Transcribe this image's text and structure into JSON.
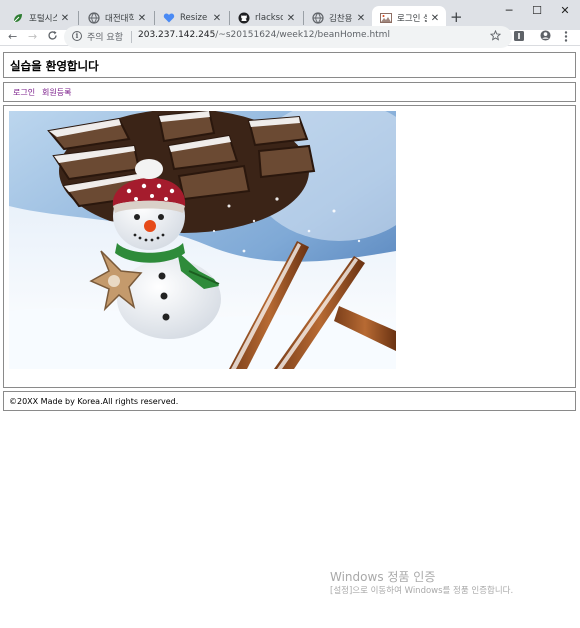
{
  "browser": {
    "tabs": [
      {
        "title": "포털시스템",
        "icon": "leaf-favicon-icon"
      },
      {
        "title": "대전대학교",
        "icon": "globe-icon"
      },
      {
        "title": "Resize multiple",
        "icon": "heart-favicon-icon"
      },
      {
        "title": "rlacksdyd",
        "icon": "github-icon"
      },
      {
        "title": "김찬용 첨부",
        "icon": "globe-icon"
      },
      {
        "title": "로그인 실습",
        "icon": "image-favicon-icon"
      }
    ],
    "active_tab_index": 5,
    "new_tab_label": "+",
    "window_controls": {
      "minimize": "─",
      "maximize": "☐",
      "close": "✕"
    },
    "nav": {
      "back": "←",
      "forward": "→",
      "reload": "C"
    },
    "address": {
      "security_label": "주의 요함",
      "host": "203.237.142.245",
      "path": "/~s20151624/week12/beanHome.html"
    },
    "toolbar_icons": [
      "star-icon",
      "extension-icon",
      "account-icon",
      "menu-icon"
    ]
  },
  "page": {
    "title": "실습을 환영합니다",
    "nav_links": [
      "로그인",
      "회원등록"
    ],
    "hero_image": "snowman-pinecone-cinnamon-photo",
    "footer": "©20XX Made by Korea.All rights reserved."
  },
  "os_watermark": {
    "title": "Windows 정품 인증",
    "subtitle": "[설정]으로 이동하여 Windows를 정품 인증합니다."
  },
  "colors": {
    "tabstrip": "#dee1e6",
    "link": "#7a1b8a",
    "box_border": "#8a8a8a"
  }
}
